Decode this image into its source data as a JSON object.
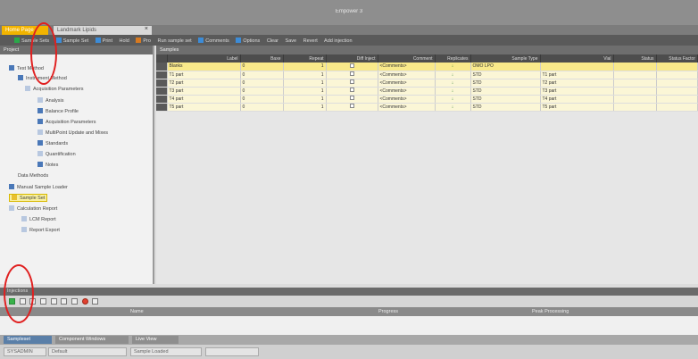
{
  "window": {
    "title": "Empower 3"
  },
  "doc_tabs": {
    "home": "Home Page",
    "landmark": "Landmark Lipids"
  },
  "toolbar": {
    "items": [
      "Sample Sets",
      "Sample Set",
      "Print",
      "Hold",
      "Pro",
      "Run sample set",
      "Comments",
      "Options",
      "Clear",
      "Save",
      "Revert",
      "Add injection"
    ]
  },
  "tree": {
    "header": "Project",
    "items": [
      {
        "label": "Test Method"
      },
      {
        "label": "Instrument Method"
      },
      {
        "label": "Acquisition Parameters"
      },
      {
        "label": "Analysis"
      },
      {
        "label": "Balance Profile"
      },
      {
        "label": "Acquisition Parameters"
      },
      {
        "label": "MultiPoint Update and Mixes"
      },
      {
        "label": "Standards"
      },
      {
        "label": "Quantification"
      },
      {
        "label": "Notes"
      },
      {
        "label": "Data Methods"
      },
      {
        "label": "Manual Sample Loader"
      },
      {
        "label": "Sample Set",
        "selected": true
      },
      {
        "label": "Calculation Report"
      },
      {
        "label": "LCM Report"
      },
      {
        "label": "Report Export"
      }
    ]
  },
  "grid": {
    "header": "Samples",
    "columns": [
      "Label",
      "Baxe",
      "Repeat",
      "Diff Inject",
      "Comment",
      "Sample Type",
      "Replicates",
      "Vial",
      "Status",
      "Status Factor"
    ],
    "rows": [
      {
        "label": "Blanks",
        "comment": "<Comments>",
        "sample_type": "OMO LPO",
        "vial": ""
      },
      {
        "label": "T1 part",
        "comment": "<Comments>",
        "sample_type": "STD",
        "vial": "T1 part"
      },
      {
        "label": "T2 part",
        "comment": "<Comments>",
        "sample_type": "STD",
        "vial": "T2 part"
      },
      {
        "label": "T3 part",
        "comment": "<Comments>",
        "sample_type": "STD",
        "vial": "T3 part"
      },
      {
        "label": "T4 part",
        "comment": "<Comments>",
        "sample_type": "STD",
        "vial": "T4 part"
      },
      {
        "label": "T5 part",
        "comment": "<Comments>",
        "sample_type": "STD",
        "vial": "T5 part"
      }
    ]
  },
  "bottom": {
    "header": "Injections",
    "columns": [
      "Name",
      "Progress",
      "Peak Processing"
    ]
  },
  "bottom_tabs": {
    "t1": "Sampleset",
    "t2": "Component Windows",
    "t3": "Live View"
  },
  "status_bar": {
    "user": "SYSADMIN",
    "project": "Default",
    "status": "Sample Loaded"
  }
}
